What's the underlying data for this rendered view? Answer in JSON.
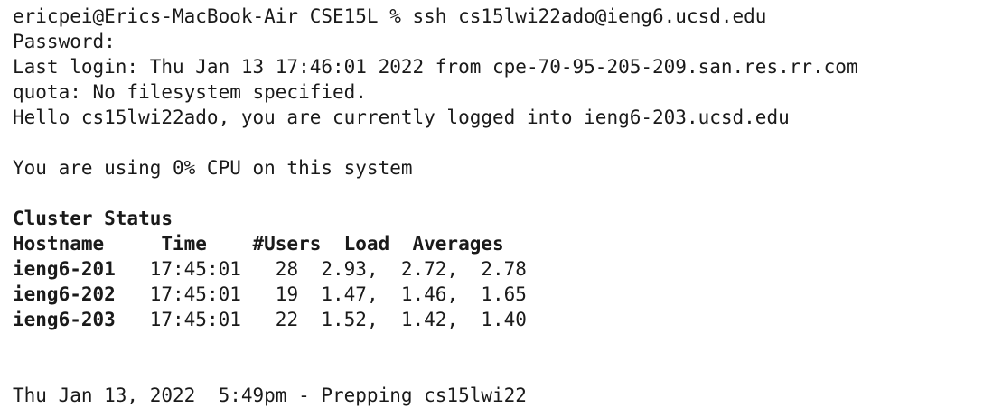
{
  "terminal": {
    "lines": [
      {
        "text": "ericpei@Erics-MacBook-Air CSE15L % ssh cs15lwi22ado@ieng6.ucsd.edu",
        "bold": false
      },
      {
        "text": "Password:",
        "bold": false
      },
      {
        "text": "Last login: Thu Jan 13 17:46:01 2022 from cpe-70-95-205-209.san.res.rr.com",
        "bold": false
      },
      {
        "text": "quota: No filesystem specified.",
        "bold": false
      },
      {
        "text": "Hello cs15lwi22ado, you are currently logged into ieng6-203.ucsd.edu",
        "bold": false
      },
      {
        "text": "",
        "bold": false
      },
      {
        "text": "You are using 0% CPU on this system",
        "bold": false
      },
      {
        "text": "",
        "bold": false
      },
      {
        "text": "Cluster Status",
        "bold": true
      },
      {
        "text": "Hostname     Time    #Users  Load  Averages",
        "bold": true
      },
      {
        "text": "ieng6-201",
        "bold": true,
        "rest": "   17:45:01   28  2.93,  2.72,  2.78"
      },
      {
        "text": "ieng6-202",
        "bold": true,
        "rest": "   17:45:01   19  1.47,  1.46,  1.65"
      },
      {
        "text": "ieng6-203",
        "bold": true,
        "rest": "   17:45:01   22  1.52,  1.42,  1.40"
      },
      {
        "text": "",
        "bold": false
      },
      {
        "text": "",
        "bold": false
      },
      {
        "text": "Thu Jan 13, 2022  5:49pm - Prepping cs15lwi22",
        "bold": false
      }
    ]
  }
}
